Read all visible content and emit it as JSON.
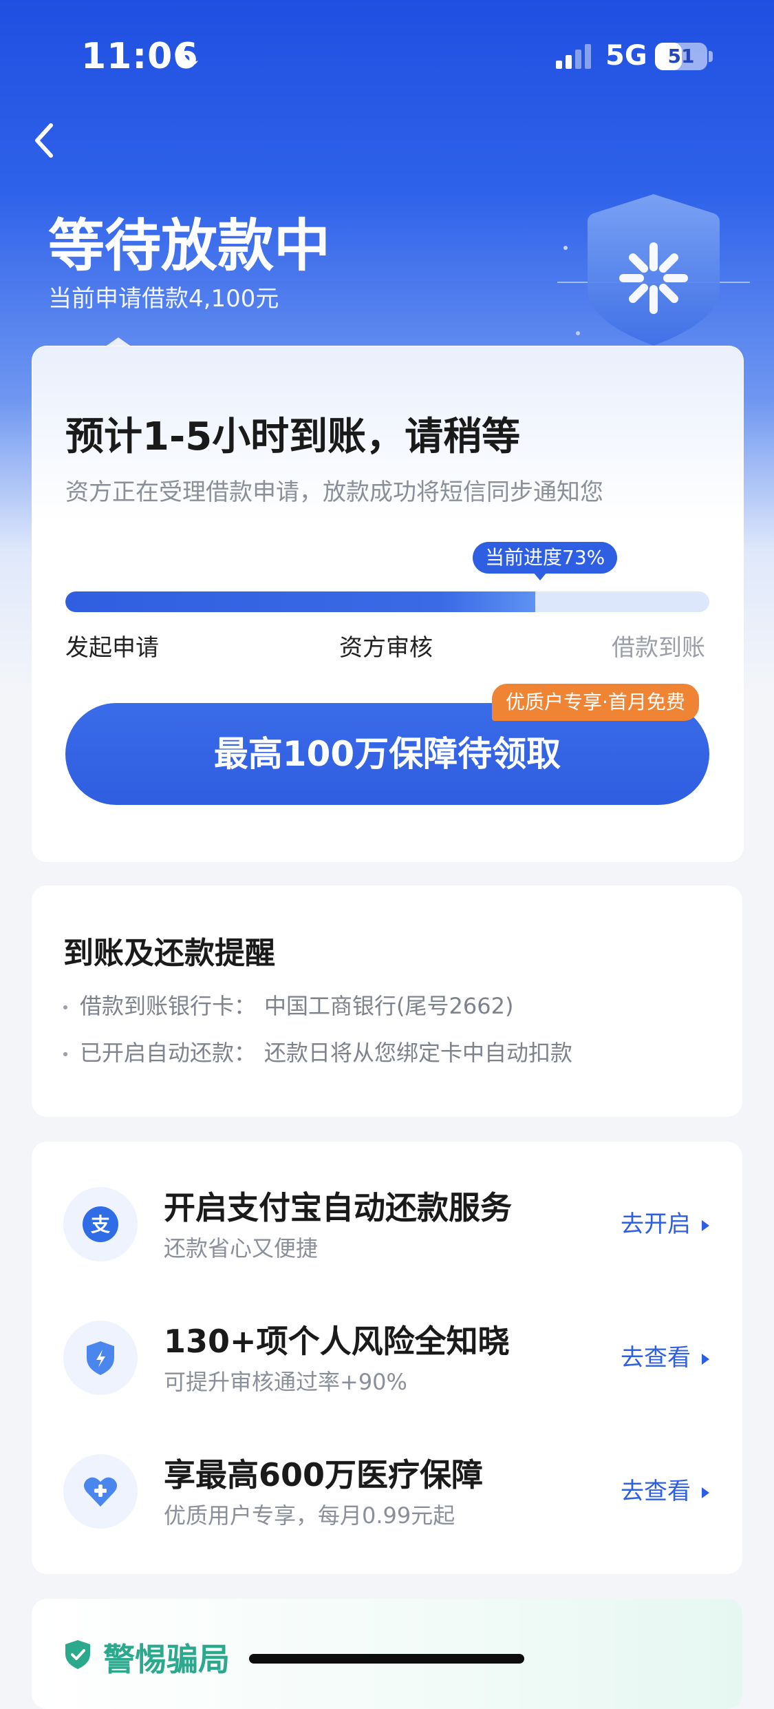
{
  "status_bar": {
    "time": "11:06",
    "network": "5G",
    "battery": "51",
    "battery_level": 0.51
  },
  "header": {
    "title": "等待放款中",
    "subtitle": "当前申请借款4,100元"
  },
  "status_card": {
    "eta_title": "预计1-5小时到账，请稍等",
    "eta_desc": "资方正在受理借款申请，放款成功将短信同步通知您",
    "progress_label": "当前进度73%",
    "progress_value": 0.73,
    "steps": [
      "发起申请",
      "资方审核",
      "借款到账"
    ],
    "cta_label": "最高100万保障待领取",
    "cta_badge": "优质户专享·首月免费"
  },
  "reminder_card": {
    "title": "到账及还款提醒",
    "lines": [
      {
        "label": "借款到账银行卡：",
        "value": "中国工商银行(尾号2662)"
      },
      {
        "label": "已开启自动还款：",
        "value": "还款日将从您绑定卡中自动扣款"
      }
    ]
  },
  "services": [
    {
      "icon": "alipay-icon",
      "title": "开启支付宝自动还款服务",
      "subtitle": "还款省心又便捷",
      "action": "去开启"
    },
    {
      "icon": "shield-bolt-icon",
      "title": "130+项个人风险全知晓",
      "subtitle": "可提升审核通过率+90%",
      "action": "去查看"
    },
    {
      "icon": "heart-plus-icon",
      "title": "享最高600万医疗保障",
      "subtitle": "优质用户专享，每月0.99元起",
      "action": "去查看"
    }
  ],
  "fraud_card": {
    "title": "警惕骗局"
  },
  "colors": {
    "brand_blue": "#2e5fe2",
    "badge_orange": "#f08435",
    "fraud_green": "#2aa98d"
  }
}
